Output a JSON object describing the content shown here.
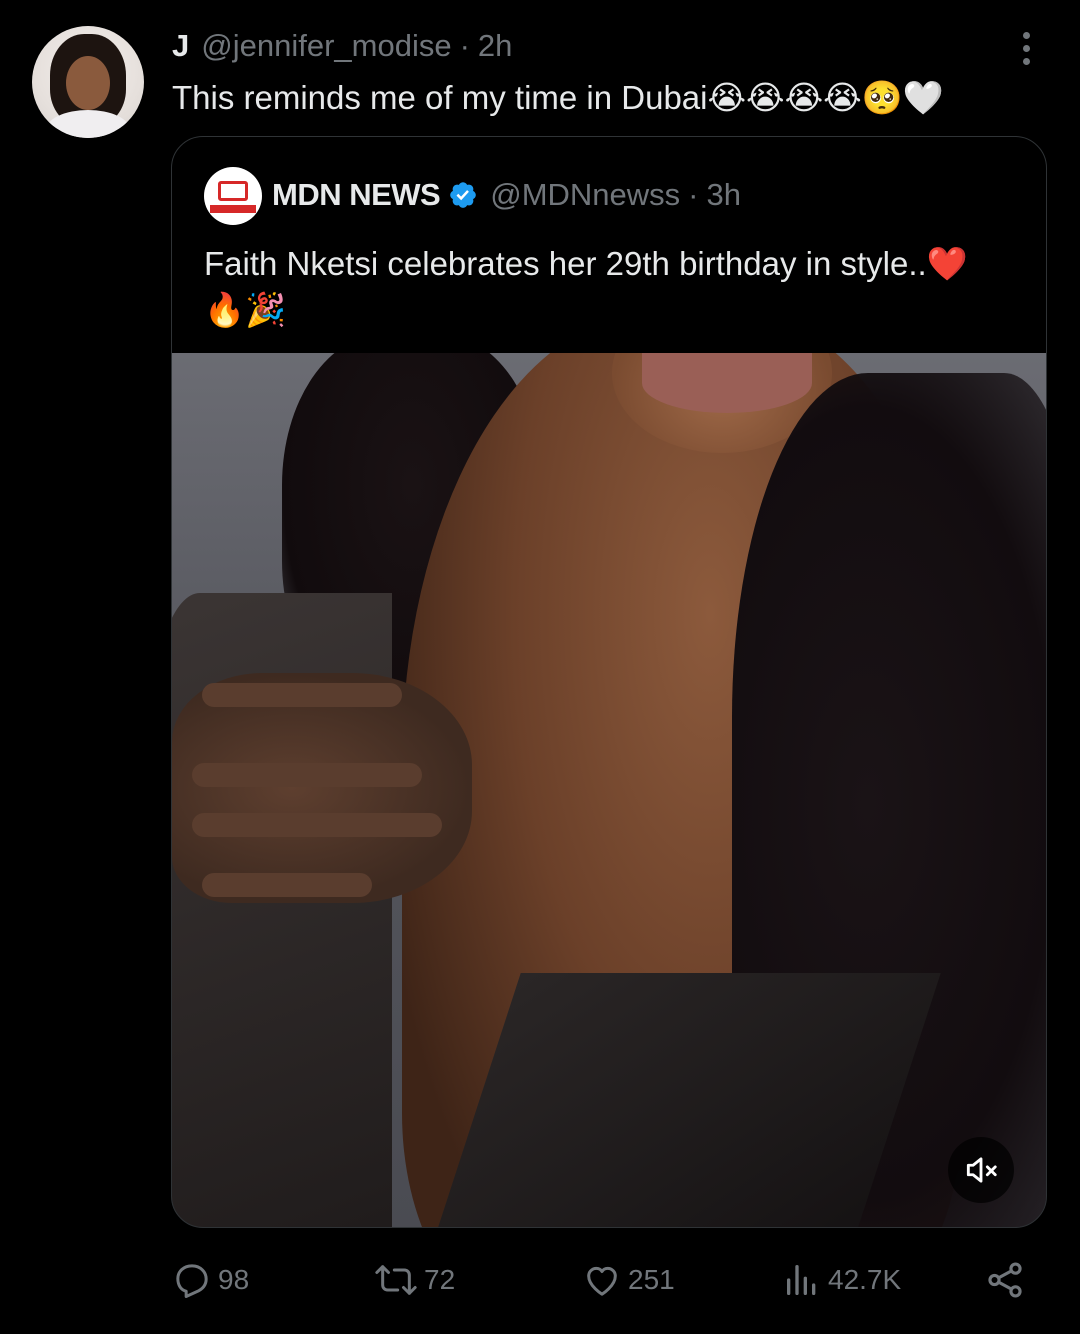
{
  "tweet": {
    "author": {
      "display_name": "J",
      "handle": "@jennifer_modise",
      "time": "2h",
      "separator": "·"
    },
    "text": "This reminds me of my time in Dubai",
    "text_emoji": "😭😭😭😭🥺🤍",
    "more_icon": "more-dots-icon"
  },
  "quoted": {
    "author": {
      "display_name": "MDN NEWS",
      "handle": "@MDNnewss",
      "time": "3h",
      "separator": "·",
      "verified": true,
      "verified_color": "#1d9bf0"
    },
    "text_line1": "Faith Nketsi celebrates her 29th birthday in style..",
    "text_line1_emoji": "❤️",
    "text_line2_emoji": "🔥🎉",
    "media": {
      "type": "video",
      "muted": true,
      "mute_icon": "volume-muted-icon"
    }
  },
  "actions": {
    "replies": "98",
    "reposts": "72",
    "likes": "251",
    "views": "42.7K"
  },
  "colors": {
    "background": "#000000",
    "text_primary": "#e7e9ea",
    "text_secondary": "#71767b",
    "border": "#2f3336",
    "brand_red": "#d62828"
  }
}
